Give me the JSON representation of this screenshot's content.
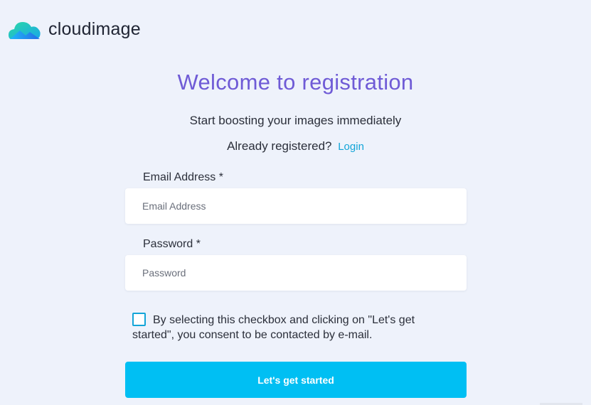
{
  "brand": {
    "name": "cloudimage",
    "logo_icon": "cloud-logo-icon"
  },
  "header": {
    "title": "Welcome to registration",
    "subtitle": "Start boosting your images immediately",
    "already_registered": "Already registered?",
    "login_link": "Login"
  },
  "form": {
    "email": {
      "label": "Email Address *",
      "placeholder": "Email Address",
      "value": ""
    },
    "password": {
      "label": "Password *",
      "placeholder": "Password",
      "value": ""
    },
    "consent_text": "By selecting this checkbox and clicking on \"Let's get started\", you consent to be contacted by e-mail.",
    "consent_checked": false,
    "submit_label": "Let's get started"
  },
  "colors": {
    "background": "#eef2fb",
    "title": "#6f5bd6",
    "link": "#13a5d8",
    "button": "#00bff3"
  }
}
